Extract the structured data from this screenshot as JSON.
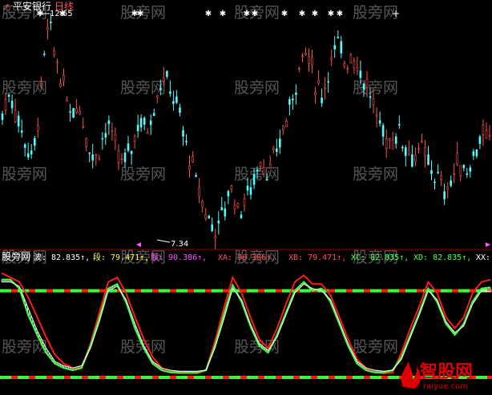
{
  "title": {
    "ticker_label": "平安银行",
    "period_label": "日线"
  },
  "colors": {
    "background": "#000000",
    "candle_up": "#ff5050",
    "candle_down": "#54fcfc",
    "markers": "#ffffff",
    "divider": "#a00000",
    "line_red": "#ff1a1a",
    "line_green": "#39ff39",
    "line_white": "#ffffff",
    "label_white": "#ffffff",
    "label_yellow": "#ffff54",
    "label_magenta": "#ff54ff",
    "label_red": "#ff5454",
    "label_green": "#54ff54",
    "watermark": "#9a9a9a",
    "logo_red": "#e00000"
  },
  "price_panel": {
    "high_label": "12.65",
    "low_label": "7.34",
    "marker_glyph": "✱",
    "plus_glyph": "+"
  },
  "indicator_panel": {
    "name": "股旁网",
    "values": [
      {
        "label": "波:",
        "value": "82.835",
        "color": "label_white"
      },
      {
        "label": "段:",
        "value": "79.471",
        "color": "label_yellow"
      },
      {
        "label": "股:",
        "value": "90.386",
        "color": "label_magenta"
      },
      {
        "label": "XA:",
        "value": "90.386",
        "color": "label_red"
      },
      {
        "label": "XB:",
        "value": "79.471",
        "color": "label_red"
      },
      {
        "label": "XC:",
        "value": "82.835",
        "color": "label_green"
      },
      {
        "label": "XD:",
        "value": "82.835",
        "color": "label_green"
      },
      {
        "label": "XX:",
        "value": "",
        "color": "label_white"
      }
    ],
    "arrow": "↑"
  },
  "watermark_text": "股旁网",
  "logo": {
    "name": "智股网",
    "url": "raiyue.com"
  },
  "chart_data": [
    {
      "type": "candlestick",
      "series": [
        {
          "name": "平安银行"
        }
      ],
      "annotations": [
        "12.65",
        "7.34"
      ],
      "close_path": [
        10.3,
        10.9,
        10.2,
        9.6,
        9.1,
        10.8,
        12.65,
        11.8,
        11.0,
        10.4,
        10.6,
        9.8,
        9.1,
        9.6,
        10.0,
        9.3,
        9.0,
        9.5,
        10.2,
        9.9,
        10.6,
        11.3,
        11.0,
        10.5,
        9.6,
        8.9,
        8.2,
        7.6,
        7.34,
        7.7,
        8.5,
        7.8,
        8.1,
        8.6,
        9.2,
        8.7,
        9.3,
        10.0,
        10.6,
        11.6,
        12.0,
        11.2,
        10.8,
        11.6,
        12.1,
        11.7,
        11.9,
        11.4,
        11.0,
        10.3,
        9.8,
        9.6,
        9.9,
        9.5,
        9.2,
        9.4,
        9.0,
        8.7,
        8.3,
        8.6,
        9.1,
        8.8,
        9.3,
        9.8,
        9.5
      ],
      "markers_top": true
    },
    {
      "type": "line",
      "series": [
        {
          "name": "波",
          "color": "#ffffff",
          "values": [
            90,
            90,
            82,
            58,
            40,
            24,
            14,
            10,
            8,
            10,
            30,
            55,
            82,
            86,
            70,
            46,
            28,
            14,
            8,
            6,
            6,
            6,
            6,
            8,
            30,
            58,
            85,
            70,
            48,
            30,
            24,
            40,
            60,
            80,
            88,
            80,
            82,
            70,
            50,
            30,
            14,
            8,
            6,
            6,
            8,
            20,
            40,
            60,
            82,
            70,
            50,
            40,
            50,
            70,
            82,
            83
          ]
        },
        {
          "name": "段",
          "color": "#ffff54",
          "values": [
            88,
            88,
            84,
            64,
            44,
            28,
            16,
            12,
            10,
            12,
            28,
            52,
            80,
            84,
            72,
            50,
            30,
            16,
            10,
            8,
            7,
            7,
            7,
            8,
            28,
            54,
            82,
            72,
            50,
            32,
            26,
            38,
            58,
            78,
            86,
            82,
            80,
            72,
            52,
            32,
            16,
            10,
            8,
            7,
            8,
            18,
            38,
            58,
            80,
            72,
            52,
            42,
            48,
            68,
            80,
            79
          ]
        },
        {
          "name": "股",
          "color": "#ff54ff",
          "values": [
            96,
            92,
            88,
            74,
            56,
            38,
            22,
            14,
            10,
            10,
            32,
            60,
            88,
            92,
            78,
            56,
            36,
            20,
            10,
            6,
            5,
            5,
            5,
            8,
            34,
            64,
            92,
            78,
            56,
            36,
            28,
            46,
            68,
            88,
            94,
            86,
            86,
            76,
            56,
            36,
            18,
            10,
            6,
            5,
            6,
            24,
            46,
            66,
            88,
            78,
            56,
            46,
            56,
            78,
            88,
            90
          ]
        },
        {
          "name": "XA",
          "color": "#ff1a1a",
          "values": [
            96,
            92,
            88,
            74,
            56,
            38,
            22,
            14,
            10,
            10,
            32,
            60,
            88,
            92,
            78,
            56,
            36,
            20,
            10,
            6,
            5,
            5,
            5,
            8,
            34,
            64,
            92,
            78,
            56,
            36,
            28,
            46,
            68,
            88,
            94,
            86,
            86,
            76,
            56,
            36,
            18,
            10,
            6,
            5,
            6,
            24,
            46,
            66,
            88,
            78,
            56,
            46,
            56,
            78,
            88,
            90
          ]
        },
        {
          "name": "XB",
          "color": "#ff1a1a",
          "values": [
            88,
            88,
            84,
            64,
            44,
            28,
            16,
            12,
            10,
            12,
            28,
            52,
            80,
            84,
            72,
            50,
            30,
            16,
            10,
            8,
            7,
            7,
            7,
            8,
            28,
            54,
            82,
            72,
            50,
            32,
            26,
            38,
            58,
            78,
            86,
            82,
            80,
            72,
            52,
            32,
            16,
            10,
            8,
            7,
            8,
            18,
            38,
            58,
            80,
            72,
            52,
            42,
            48,
            68,
            80,
            79
          ]
        },
        {
          "name": "XC",
          "color": "#39ff39",
          "values": [
            90,
            90,
            82,
            58,
            40,
            24,
            14,
            10,
            8,
            10,
            30,
            55,
            82,
            86,
            70,
            46,
            28,
            14,
            8,
            6,
            6,
            6,
            6,
            8,
            30,
            58,
            85,
            70,
            48,
            30,
            24,
            40,
            60,
            80,
            88,
            80,
            82,
            70,
            50,
            30,
            14,
            8,
            6,
            6,
            8,
            20,
            40,
            60,
            82,
            70,
            50,
            40,
            50,
            70,
            82,
            83
          ]
        },
        {
          "name": "XD",
          "color": "#39ff39",
          "values": [
            90,
            90,
            82,
            58,
            40,
            24,
            14,
            10,
            8,
            10,
            30,
            55,
            82,
            86,
            70,
            46,
            28,
            14,
            8,
            6,
            6,
            6,
            6,
            8,
            30,
            58,
            85,
            70,
            48,
            30,
            24,
            40,
            60,
            80,
            88,
            80,
            82,
            70,
            50,
            30,
            14,
            8,
            6,
            6,
            8,
            20,
            40,
            60,
            82,
            70,
            50,
            40,
            50,
            70,
            82,
            83
          ]
        }
      ],
      "reference_lines": [
        80,
        0
      ],
      "ylim": [
        0,
        100
      ]
    }
  ]
}
